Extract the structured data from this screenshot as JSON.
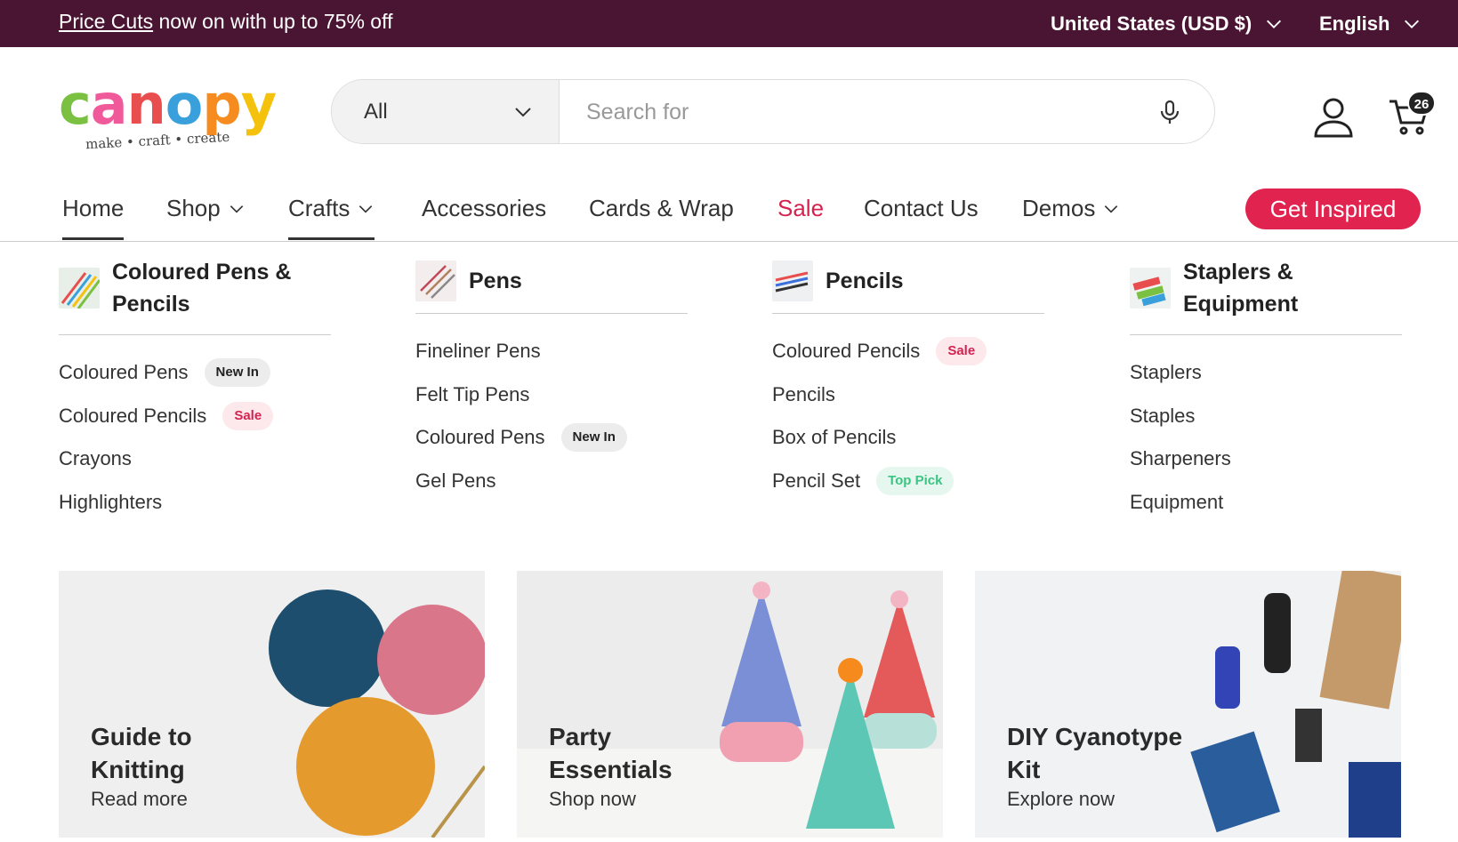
{
  "announcement": {
    "promo_link": "Price Cuts",
    "promo_text": " now on with up to 75% off",
    "country": "United States (USD $)",
    "language": "English"
  },
  "logo": {
    "word": "canopy",
    "letters": [
      "c",
      "a",
      "n",
      "o",
      "p",
      "y"
    ],
    "letter_colors": [
      "#7ac142",
      "#f15a9a",
      "#e94e4e",
      "#3aa0dc",
      "#f68b1f",
      "#f4c20d"
    ],
    "tagline": "make • craft • create"
  },
  "search": {
    "category": "All",
    "placeholder": "Search for"
  },
  "cart": {
    "count": "26"
  },
  "nav": {
    "items": [
      "Home",
      "Shop",
      "Crafts",
      "Accessories",
      "Cards & Wrap",
      "Sale",
      "Contact Us",
      "Demos"
    ],
    "cta": "Get Inspired"
  },
  "menu": [
    {
      "title": "Coloured Pens & Pencils",
      "items": [
        {
          "label": "Coloured Pens",
          "badge": "New In"
        },
        {
          "label": "Coloured Pencils",
          "badge": "Sale"
        },
        {
          "label": "Crayons"
        },
        {
          "label": "Highlighters"
        }
      ]
    },
    {
      "title": "Pens",
      "items": [
        {
          "label": "Fineliner Pens"
        },
        {
          "label": "Felt Tip Pens"
        },
        {
          "label": "Coloured Pens",
          "badge": "New In"
        },
        {
          "label": "Gel Pens"
        }
      ]
    },
    {
      "title": "Pencils",
      "items": [
        {
          "label": "Coloured Pencils",
          "badge": "Sale"
        },
        {
          "label": "Pencils"
        },
        {
          "label": "Box of Pencils"
        },
        {
          "label": "Pencil Set",
          "badge": "Top Pick"
        }
      ]
    },
    {
      "title": "Staplers & Equipment",
      "items": [
        {
          "label": "Staplers"
        },
        {
          "label": "Staples"
        },
        {
          "label": "Sharpeners"
        },
        {
          "label": "Equipment"
        }
      ]
    }
  ],
  "cards": [
    {
      "title_line1": "Guide to",
      "title_line2": "Knitting",
      "link": "Read more"
    },
    {
      "title_line1": "Party",
      "title_line2": "Essentials",
      "link": "Shop now"
    },
    {
      "title_line1": "DIY Cyanotype",
      "title_line2": "Kit",
      "link": "Explore now"
    }
  ],
  "colors": {
    "announce_bg": "#4a1533",
    "accent": "#e0234f",
    "sale_text": "#d5234f",
    "top_pick": "#3cc484"
  }
}
